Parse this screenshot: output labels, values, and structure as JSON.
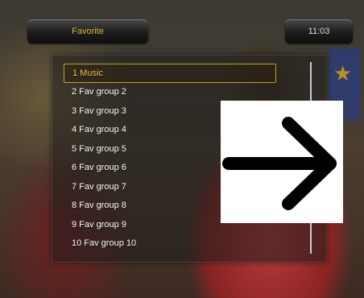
{
  "header": {
    "title": "Favorite",
    "clock": "11:03"
  },
  "list": {
    "items": [
      {
        "label": "1 Music",
        "selected": true
      },
      {
        "label": "2 Fav group 2"
      },
      {
        "label": "3 Fav group 3"
      },
      {
        "label": "4 Fav group 4"
      },
      {
        "label": "5 Fav group 5"
      },
      {
        "label": "6 Fav group 6"
      },
      {
        "label": "7 Fav group 7"
      },
      {
        "label": "8 Fav group 8"
      },
      {
        "label": "9 Fav group 9"
      },
      {
        "label": "10 Fav group 10"
      }
    ]
  },
  "overlay": {
    "icon": "right-arrow-icon"
  },
  "colors": {
    "accent": "#e0b23a",
    "selection_border": "#c89a2c",
    "panel": "#1e1e1e"
  }
}
